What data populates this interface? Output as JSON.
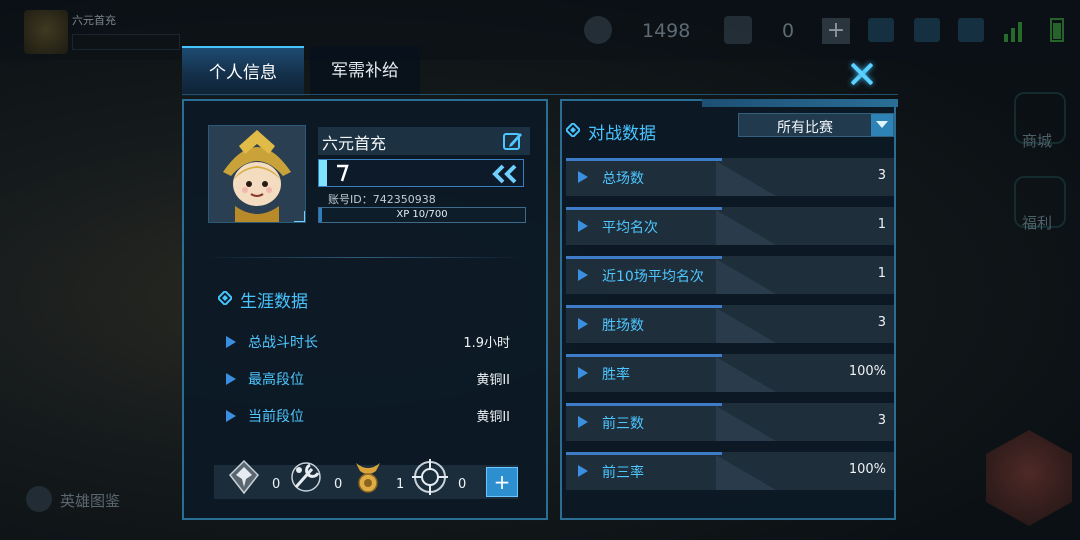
{
  "background": {
    "player_name": "六元首充",
    "currency_a": "1498",
    "currency_b": "0",
    "side_buttons": [
      "商城",
      "福利"
    ],
    "hero_gallery": "英雄图鉴"
  },
  "tabs": [
    {
      "label": "个人信息",
      "active": true
    },
    {
      "label": "军需补给",
      "active": false
    }
  ],
  "profile": {
    "name": "六元首充",
    "account_id": "账号ID：742350938",
    "xp_text": "XP 10/700",
    "xp_current": 10,
    "xp_max": 700
  },
  "career": {
    "title": "生涯数据",
    "rows": [
      {
        "label": "总战斗时长",
        "value": "1.9小时"
      },
      {
        "label": "最高段位",
        "value": "黄铜II"
      },
      {
        "label": "当前段位",
        "value": "黄铜II"
      }
    ]
  },
  "badges": [
    {
      "icon": "eagle-emblem-icon",
      "count": "0"
    },
    {
      "icon": "wrench-emblem-icon",
      "count": "0"
    },
    {
      "icon": "gold-medal-icon",
      "count": "1"
    },
    {
      "icon": "crosshair-emblem-icon",
      "count": "0"
    }
  ],
  "battle": {
    "title": "对战数据",
    "filter": "所有比赛",
    "rows": [
      {
        "label": "总场数",
        "value": "3"
      },
      {
        "label": "平均名次",
        "value": "1"
      },
      {
        "label": "近10场平均名次",
        "value": "1"
      },
      {
        "label": "胜场数",
        "value": "3"
      },
      {
        "label": "胜率",
        "value": "100%"
      },
      {
        "label": "前三数",
        "value": "3"
      },
      {
        "label": "前三率",
        "value": "100%"
      }
    ]
  },
  "colors": {
    "accent": "#48c4ff",
    "panel_border": "#2a6e96",
    "button": "#2d8fd0"
  }
}
